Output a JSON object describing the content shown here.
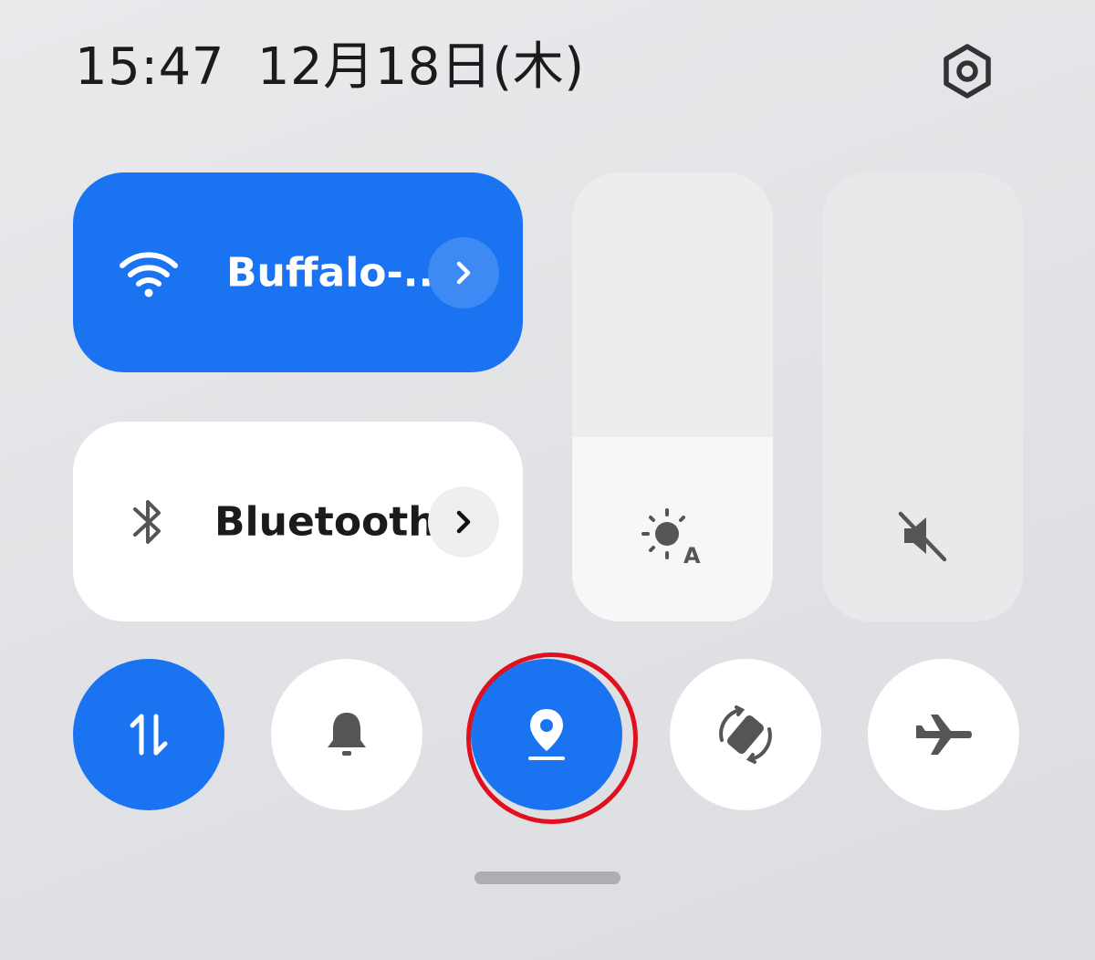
{
  "status": {
    "time": "15:47",
    "date": "12月18日(木)"
  },
  "settings": {
    "icon": "gear-icon"
  },
  "wifi": {
    "label": "Buffalo-..",
    "active": true,
    "icon": "wifi-icon"
  },
  "bluetooth": {
    "label": "Bluetooth",
    "active": false,
    "icon": "bluetooth-icon"
  },
  "sliders": {
    "brightness": {
      "icon": "auto-brightness-icon",
      "level": 0.41
    },
    "volume": {
      "icon": "mute-icon",
      "level": 0.0
    }
  },
  "quick_toggles": [
    {
      "name": "mobile-data",
      "icon": "data-arrows-icon",
      "active": true
    },
    {
      "name": "sound",
      "icon": "bell-icon",
      "active": false
    },
    {
      "name": "location",
      "icon": "location-pin-icon",
      "active": true,
      "highlighted": true
    },
    {
      "name": "auto-rotate",
      "icon": "rotate-icon",
      "active": false
    },
    {
      "name": "airplane-mode",
      "icon": "airplane-icon",
      "active": false
    }
  ],
  "colors": {
    "accent": "#1a74f2",
    "highlight": "#e0101e",
    "tile_bg": "#ffffff"
  }
}
